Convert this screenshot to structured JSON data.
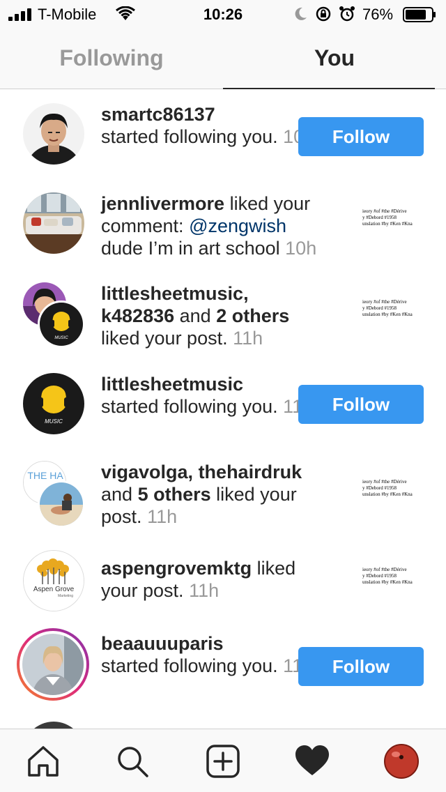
{
  "status_bar": {
    "carrier": "T-Mobile",
    "time": "10:26",
    "battery": "76%"
  },
  "tabs": {
    "following": "Following",
    "you": "You"
  },
  "follow_label": "Follow",
  "notifications": [
    {
      "username": "smartc86137",
      "action": "started following you.",
      "time": "10h",
      "has_follow_button": true
    },
    {
      "username": "jennlivermore",
      "action": "liked your comment:",
      "mention": "@zengwish",
      "comment": "dude I’m in art school",
      "time": "10h",
      "thumbnail_lines": [
        "ieory #of #the #Dérive",
        "y #Debord #1958",
        "unslation #by #Ken #Kna"
      ]
    },
    {
      "username": "littlesheetmusic,",
      "username2": "k482836",
      "joiner": "and",
      "others": "2 others",
      "action": "liked your post.",
      "time": "11h",
      "thumbnail_lines": [
        "ieory #of #the #Dérive",
        "y #Debord #1958",
        "unslation #by #Ken #Kna"
      ],
      "logo_text": "MUSIC"
    },
    {
      "username": "littlesheetmusic",
      "action": "started following you.",
      "time": "11h",
      "has_follow_button": true,
      "logo_text": "MUSIC"
    },
    {
      "username": "vigavolga,",
      "username2": "thehairdruk",
      "joiner": "and",
      "others": "5 others",
      "action": "liked your post.",
      "time": "11h",
      "thumbnail_lines": [
        "ieory #of #the #Dérive",
        "y #Debord #1958",
        "unslation #by #Ken #Kna"
      ],
      "logo_text": "THE HA"
    },
    {
      "username": "aspengrovemktg",
      "action": "liked your post.",
      "time": "11h",
      "thumbnail_lines": [
        "ieory #of #the #Dérive",
        "y #Debord #1958",
        "unslation #by #Ken #Kna"
      ],
      "logo_text": "Aspen Grove",
      "logo_subtext": "Marketing"
    },
    {
      "username": "beaauuuparis",
      "action": "started following you.",
      "time": "11h",
      "has_follow_button": true
    }
  ],
  "colors": {
    "follow_button": "#3897f0",
    "mention": "#003569",
    "timestamp": "#999999"
  },
  "bottom_nav": [
    "home-icon",
    "search-icon",
    "add-post-icon",
    "activity-heart-icon",
    "profile-avatar"
  ]
}
